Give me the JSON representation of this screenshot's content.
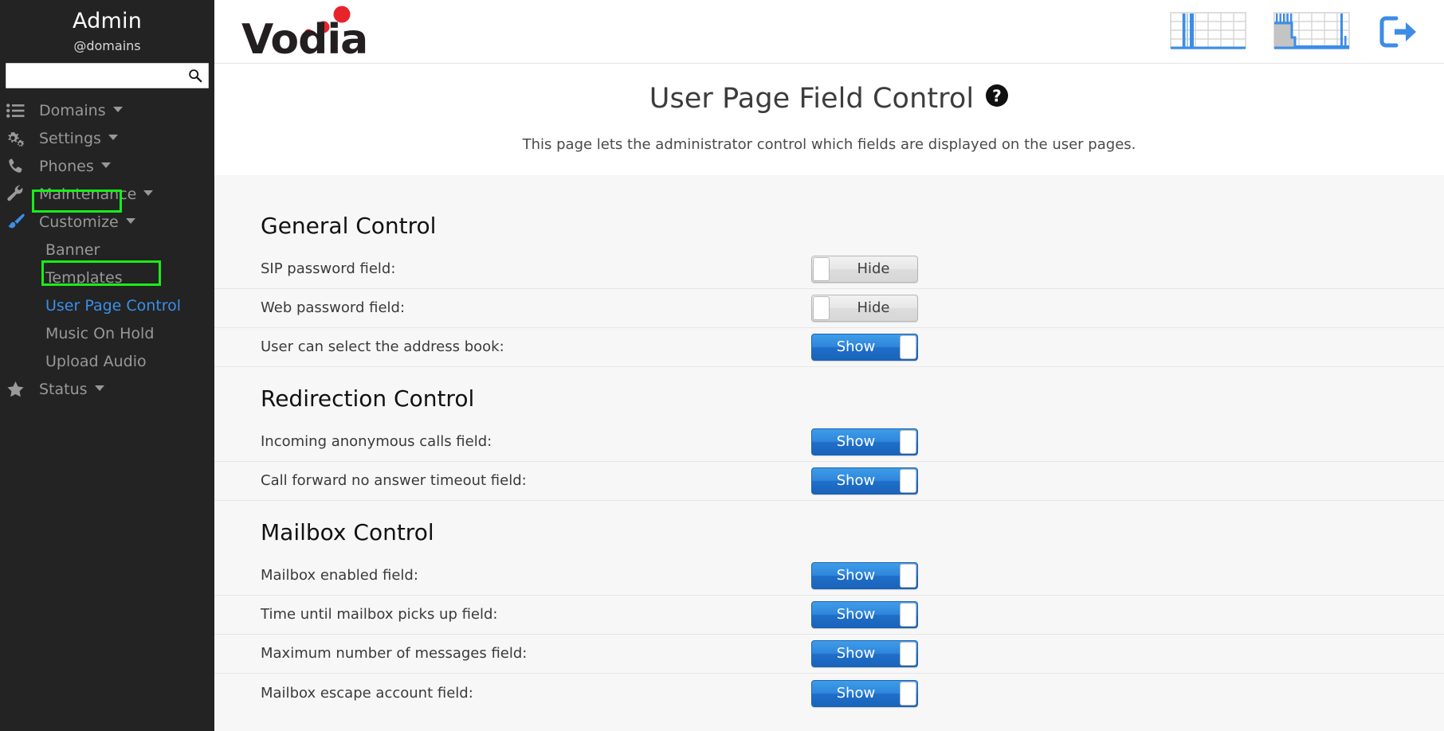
{
  "sidebar": {
    "user_name": "Admin",
    "user_domain": "@domains",
    "search": {
      "value": "",
      "placeholder": ""
    },
    "nav": [
      {
        "label": "Domains",
        "icon": "list-icon",
        "has_caret": true
      },
      {
        "label": "Settings",
        "icon": "gears-icon",
        "has_caret": true
      },
      {
        "label": "Phones",
        "icon": "phone-icon",
        "has_caret": true
      },
      {
        "label": "Maintenance",
        "icon": "wrench-icon",
        "has_caret": true
      },
      {
        "label": "Customize",
        "icon": "paintbrush-icon",
        "has_caret": true
      }
    ],
    "sub_items": [
      {
        "label": "Banner",
        "active": false
      },
      {
        "label": "Templates",
        "active": false
      },
      {
        "label": "User Page Control",
        "active": true
      },
      {
        "label": "Music On Hold",
        "active": false
      },
      {
        "label": "Upload Audio",
        "active": false
      }
    ],
    "status": {
      "label": "Status",
      "icon": "star-icon",
      "has_caret": true
    },
    "highlight_color": "#19ed19",
    "active_link_color": "#3b8fe8"
  },
  "header": {
    "logo_text": "Vodia",
    "logo_dot_color": "#e8232a",
    "icons": [
      {
        "name": "bar-chart-icon"
      },
      {
        "name": "area-chart-icon"
      },
      {
        "name": "logout-icon"
      }
    ],
    "accent_color": "#3d8ce8"
  },
  "page": {
    "title": "User Page Field Control",
    "help_icon": "question-mark-circle-icon",
    "subtitle": "This page lets the administrator control which fields are displayed on the user pages."
  },
  "sections": [
    {
      "heading": "General Control",
      "rows": [
        {
          "label": "SIP password field:",
          "state": "off",
          "state_label": "Hide"
        },
        {
          "label": "Web password field:",
          "state": "off",
          "state_label": "Hide"
        },
        {
          "label": "User can select the address book:",
          "state": "on",
          "state_label": "Show"
        }
      ]
    },
    {
      "heading": "Redirection Control",
      "rows": [
        {
          "label": "Incoming anonymous calls field:",
          "state": "on",
          "state_label": "Show"
        },
        {
          "label": "Call forward no answer timeout field:",
          "state": "on",
          "state_label": "Show"
        }
      ]
    },
    {
      "heading": "Mailbox Control",
      "rows": [
        {
          "label": "Mailbox enabled field:",
          "state": "on",
          "state_label": "Show"
        },
        {
          "label": "Time until mailbox picks up field:",
          "state": "on",
          "state_label": "Show"
        },
        {
          "label": "Maximum number of messages field:",
          "state": "on",
          "state_label": "Show"
        },
        {
          "label": "Mailbox escape account field:",
          "state": "on",
          "state_label": "Show"
        }
      ]
    }
  ]
}
